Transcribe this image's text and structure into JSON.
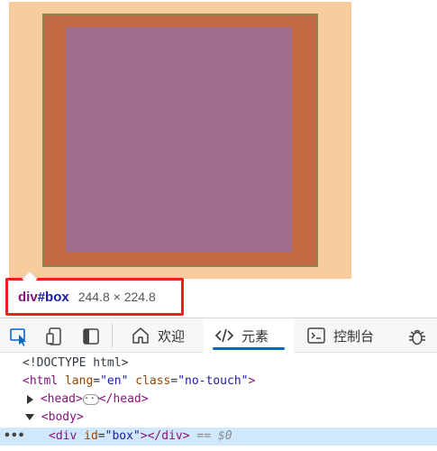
{
  "tooltip": {
    "tag": "div",
    "id": "#box",
    "size": "244.8 × 224.8"
  },
  "devtools": {
    "tabs": [
      {
        "label": "欢迎",
        "icon": "home-icon"
      },
      {
        "label": "元素",
        "icon": "code-icon",
        "active": true
      },
      {
        "label": "控制台",
        "icon": "console-icon"
      }
    ],
    "tools": [
      "inspect-icon",
      "device-emulation-icon",
      "dock-side-icon",
      "bug-icon"
    ],
    "accent": "#0a67c4"
  },
  "dom": {
    "doctype": "<!DOCTYPE html>",
    "html_open": "<html",
    "html_lang_attr": "lang",
    "html_lang_val": "\"en\"",
    "html_class_attr": "class",
    "html_class_val": "\"no-touch\"",
    "html_close_bracket": ">",
    "head_open": "<head>",
    "head_ellipsis": "···",
    "head_close": "</head>",
    "body_open": "<body>",
    "div_open": "<div",
    "div_id_attr": "id",
    "div_id_val": "\"box\"",
    "div_close": "></div>",
    "eq_marker": "== $0",
    "overflow_dots": "•••"
  },
  "colors": {
    "margin": "#f9cc9d",
    "border": "#c46b45",
    "content": "#9f6e8f",
    "tooltip_border": "#e8231f"
  }
}
